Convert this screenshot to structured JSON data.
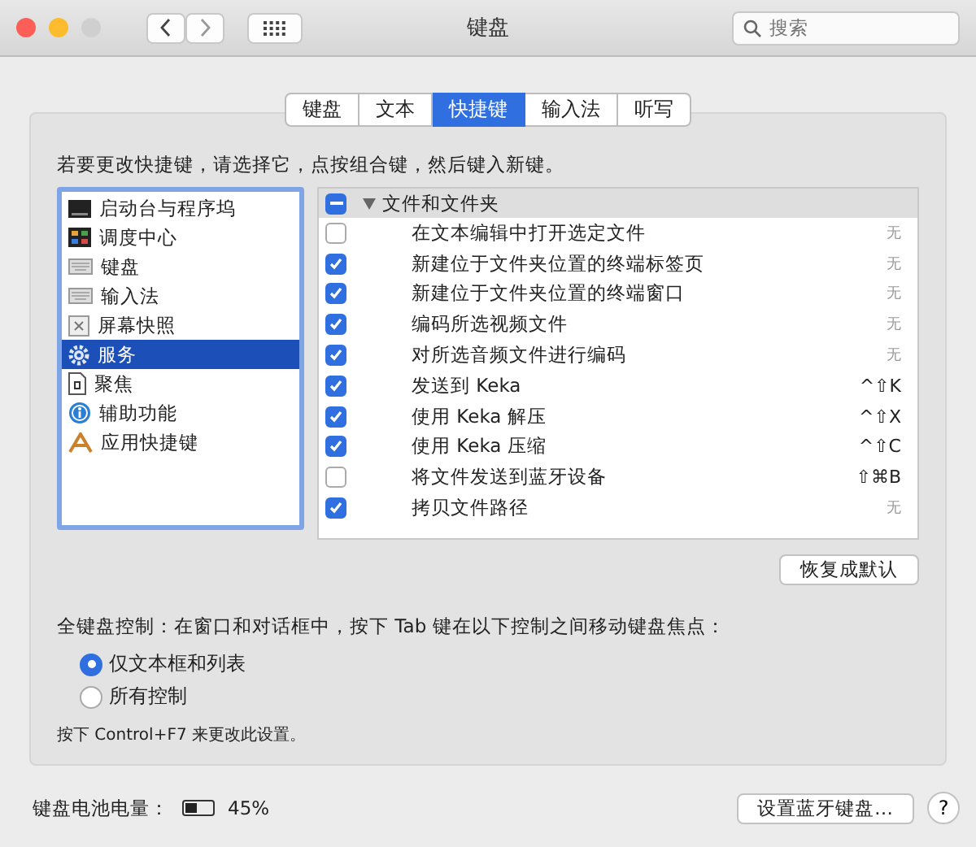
{
  "window": {
    "title": "键盘",
    "search": {
      "placeholder": "搜索"
    }
  },
  "tabs": [
    {
      "label": "键盘",
      "selected": false
    },
    {
      "label": "文本",
      "selected": false
    },
    {
      "label": "快捷键",
      "selected": true
    },
    {
      "label": "输入法",
      "selected": false
    },
    {
      "label": "听写",
      "selected": false
    }
  ],
  "instruction": "若要更改快捷键，请选择它，点按组合键，然后键入新键。",
  "categories": [
    {
      "label": "启动台与程序坞",
      "selected": false
    },
    {
      "label": "调度中心",
      "selected": false
    },
    {
      "label": "键盘",
      "selected": false
    },
    {
      "label": "输入法",
      "selected": false
    },
    {
      "label": "屏幕快照",
      "selected": false
    },
    {
      "label": "服务",
      "selected": true
    },
    {
      "label": "聚焦",
      "selected": false
    },
    {
      "label": "辅助功能",
      "selected": false
    },
    {
      "label": "应用快捷键",
      "selected": false
    }
  ],
  "shortcuts": {
    "group": {
      "label": "文件和文件夹",
      "checked": true,
      "mixed": true,
      "expanded": true
    },
    "items": [
      {
        "label": "在文本编辑中打开选定文件",
        "checked": false,
        "key": "无"
      },
      {
        "label": "新建位于文件夹位置的终端标签页",
        "checked": true,
        "key": "无"
      },
      {
        "label": "新建位于文件夹位置的终端窗口",
        "checked": true,
        "key": "无"
      },
      {
        "label": "编码所选视频文件",
        "checked": true,
        "key": "无"
      },
      {
        "label": "对所选音频文件进行编码",
        "checked": true,
        "key": "无"
      },
      {
        "label": "发送到 Keka",
        "checked": true,
        "key": "^⇧K"
      },
      {
        "label": "使用 Keka 解压",
        "checked": true,
        "key": "^⇧X"
      },
      {
        "label": "使用 Keka 压缩",
        "checked": true,
        "key": "^⇧C"
      },
      {
        "label": "将文件发送到蓝牙设备",
        "checked": false,
        "key": "⇧⌘B"
      },
      {
        "label": "拷贝文件路径",
        "checked": true,
        "key": "无"
      }
    ]
  },
  "restore_button": "恢复成默认",
  "full_keyboard": {
    "label": "全键盘控制：在窗口和对话框中，按下 Tab 键在以下控制之间移动键盘焦点：",
    "options": [
      {
        "label": "仅文本框和列表",
        "selected": true
      },
      {
        "label": "所有控制",
        "selected": false
      }
    ],
    "note": "按下 Control+F7 来更改此设置。"
  },
  "battery": {
    "label": "键盘电池电量：",
    "level": 0.45,
    "reading": "45%"
  },
  "bluetooth_button": "设置蓝牙键盘…",
  "help_button": "?"
}
